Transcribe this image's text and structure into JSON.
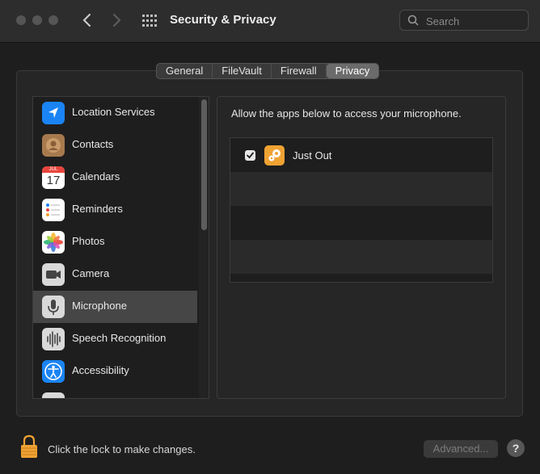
{
  "window": {
    "title": "Security & Privacy"
  },
  "search": {
    "placeholder": "Search",
    "value": ""
  },
  "tabs": [
    {
      "label": "General",
      "active": false
    },
    {
      "label": "FileVault",
      "active": false
    },
    {
      "label": "Firewall",
      "active": false
    },
    {
      "label": "Privacy",
      "active": true
    }
  ],
  "sidebar": {
    "items": [
      {
        "label": "Location Services",
        "icon": "location-arrow-icon",
        "selected": false
      },
      {
        "label": "Contacts",
        "icon": "contacts-icon",
        "selected": false
      },
      {
        "label": "Calendars",
        "icon": "calendar-icon",
        "selected": false
      },
      {
        "label": "Reminders",
        "icon": "reminders-icon",
        "selected": false
      },
      {
        "label": "Photos",
        "icon": "photos-icon",
        "selected": false
      },
      {
        "label": "Camera",
        "icon": "camera-icon",
        "selected": false
      },
      {
        "label": "Microphone",
        "icon": "microphone-icon",
        "selected": true
      },
      {
        "label": "Speech Recognition",
        "icon": "speech-waveform-icon",
        "selected": false
      },
      {
        "label": "Accessibility",
        "icon": "accessibility-icon",
        "selected": false
      }
    ],
    "calendar_month": "JUL",
    "calendar_day": "17"
  },
  "panel": {
    "description": "Allow the apps below to access your microphone.",
    "apps": [
      {
        "name": "Just Out",
        "checked": true,
        "icon": "gears-app-icon"
      }
    ]
  },
  "footer": {
    "lock_text": "Click the lock to make changes.",
    "advanced_label": "Advanced...",
    "help_label": "?"
  },
  "colors": {
    "background": "#1e1e1e",
    "selected_row": "#464646",
    "active_tab": "#6b6b6b",
    "lock": "#f0a233"
  }
}
